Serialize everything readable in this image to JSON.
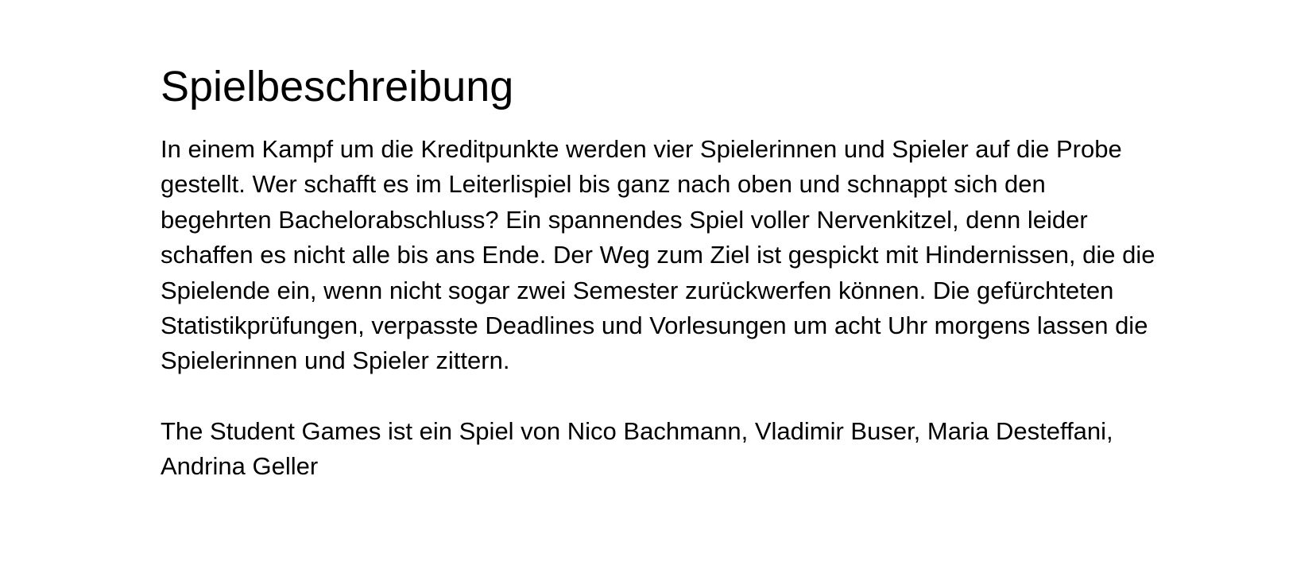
{
  "document": {
    "title": "Spielbeschreibung",
    "paragraphs": [
      "In einem Kampf um die Kreditpunkte werden vier Spielerinnen und Spieler auf die Probe gestellt. Wer schafft es im Leiterlispiel bis ganz nach oben und schnappt sich den begehrten Bachelorabschluss? Ein spannendes Spiel voller Nervenkitzel, denn leider schaffen es nicht alle bis ans Ende. Der Weg zum Ziel ist gespickt mit Hindernissen, die die Spielende ein, wenn nicht sogar zwei Semester zurückwerfen können. Die gefürchteten Statistikprüfungen, verpasste Deadlines und Vorlesungen um acht Uhr morgens lassen die Spielerinnen und Spieler zittern.",
      "The Student Games ist ein Spiel von Nico Bachmann, Vladimir Buser, Maria Desteffani, Andrina Geller"
    ]
  }
}
